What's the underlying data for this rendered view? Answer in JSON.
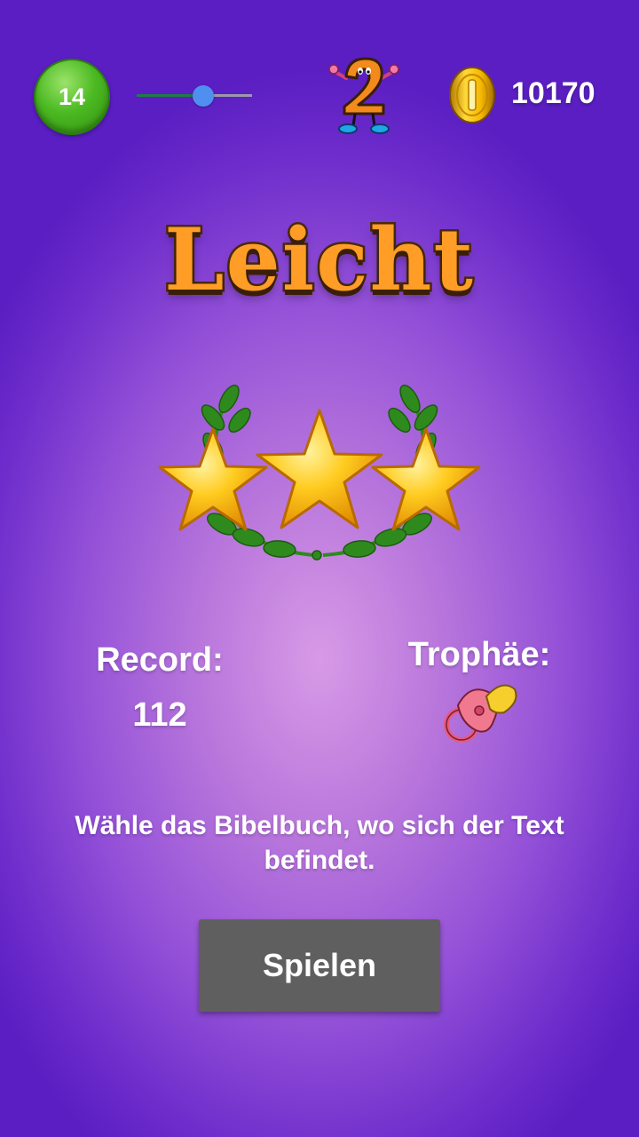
{
  "hud": {
    "level_number": "14",
    "level_progress": 0.58,
    "mascot_icon": "number-two-mascot-icon",
    "coin_icon": "gold-coin-icon",
    "coins": "10170"
  },
  "difficulty_title": "Leicht",
  "rating": {
    "stars_earned": 3,
    "stars_total": 3,
    "icon": "laurel-stars-icon"
  },
  "stats": {
    "record_label": "Record:",
    "record_value": "112",
    "trophy_label": "Trophäe:",
    "trophy_icon": "pacifier-icon"
  },
  "instruction": "Wähle das Bibelbuch, wo sich der Text befindet.",
  "play_button_label": "Spielen",
  "colors": {
    "background": "#9552d8",
    "title_orange": "#ff9d26",
    "level_badge_green": "#4cba22",
    "slider_thumb": "#4e8ff0",
    "button_gray": "#5f5f5f"
  }
}
